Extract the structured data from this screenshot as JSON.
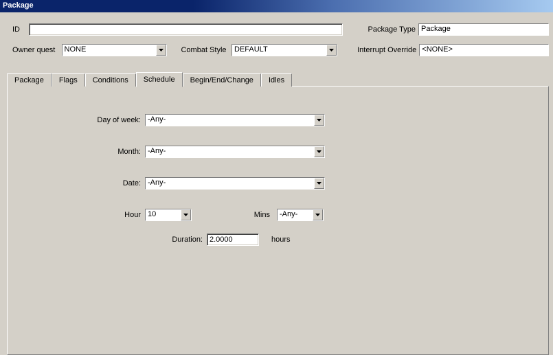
{
  "window": {
    "title": "Package"
  },
  "header": {
    "id_label": "ID",
    "id_value": "",
    "package_type_label": "Package Type",
    "package_type_value": "Package",
    "owner_quest_label": "Owner quest",
    "owner_quest_value": "NONE",
    "combat_style_label": "Combat Style",
    "combat_style_value": "DEFAULT",
    "interrupt_override_label": "Interrupt Override",
    "interrupt_override_value": "<NONE>"
  },
  "tabs": {
    "t0": "Package",
    "t1": "Flags",
    "t2": "Conditions",
    "t3": "Schedule",
    "t4": "Begin/End/Change",
    "t5": "Idles",
    "active": "Schedule"
  },
  "schedule": {
    "day_of_week_label": "Day of week:",
    "day_of_week_value": "-Any-",
    "month_label": "Month:",
    "month_value": "-Any-",
    "date_label": "Date:",
    "date_value": "-Any-",
    "hour_label": "Hour",
    "hour_value": "10",
    "mins_label": "Mins",
    "mins_value": "-Any-",
    "duration_label": "Duration:",
    "duration_value": "2.0000",
    "duration_unit": "hours"
  }
}
